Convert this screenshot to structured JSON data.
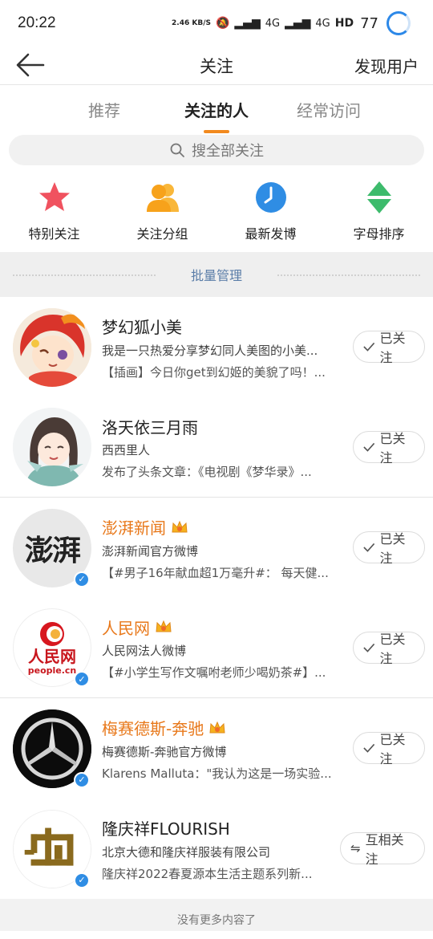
{
  "status_bar": {
    "time": "20:22",
    "net_speed": "2.46 KB/S",
    "signal": "4G",
    "hd": "HD",
    "battery": "77"
  },
  "header": {
    "title": "关注",
    "right_action": "发现用户"
  },
  "tabs": [
    {
      "label": "推荐",
      "active": false
    },
    {
      "label": "关注的人",
      "active": true
    },
    {
      "label": "经常访问",
      "active": false
    }
  ],
  "search": {
    "placeholder": "搜全部关注"
  },
  "shortcuts": [
    {
      "label": "特别关注",
      "icon": "star-icon"
    },
    {
      "label": "关注分组",
      "icon": "group-icon"
    },
    {
      "label": "最新发博",
      "icon": "clock-icon"
    },
    {
      "label": "字母排序",
      "icon": "sort-icon"
    }
  ],
  "batch": {
    "label": "批量管理"
  },
  "follows": [
    {
      "name": "梦幻狐小美",
      "desc": "我是一只热爱分享梦幻同人美图的小美...",
      "post": "【插画】今日你get到幻姬的美貌了吗！...",
      "button": "已关注",
      "vip": false,
      "verified": false
    },
    {
      "name": "洛天依三月雨",
      "desc": "西西里人",
      "post": "发布了头条文章：《电视剧《梦华录》...",
      "button": "已关注",
      "vip": false,
      "verified": false
    },
    {
      "name": "澎湃新闻",
      "desc": "澎湃新闻官方微博",
      "post": "【#男子16年献血超1万毫升#： 每天健...",
      "button": "已关注",
      "vip": true,
      "verified": true
    },
    {
      "name": "人民网",
      "desc": "人民网法人微博",
      "post": "【#小学生写作文嘱咐老师少喝奶茶#】...",
      "button": "已关注",
      "vip": true,
      "verified": true
    },
    {
      "name": "梅赛德斯-奔驰",
      "desc": "梅赛德斯-奔驰官方微博",
      "post": "Klarens Malluta：\"我认为这是一场实验...",
      "button": "已关注",
      "vip": true,
      "verified": true
    },
    {
      "name": "隆庆祥FLOURISH",
      "desc": "北京大德和隆庆祥服装有限公司",
      "post": "隆庆祥2022春夏源本生活主题系列新...",
      "button": "互相关注",
      "vip": false,
      "verified": true
    }
  ],
  "avatar_text": {
    "pengpai": "澎湃",
    "people_cn": "人民网",
    "people_en": "people.cn"
  },
  "footer": {
    "text": "没有更多内容了"
  },
  "colors": {
    "accent": "#f28a1e",
    "vip_name": "#e8781a",
    "verified": "#2f8de4",
    "link": "#5a7da8"
  }
}
